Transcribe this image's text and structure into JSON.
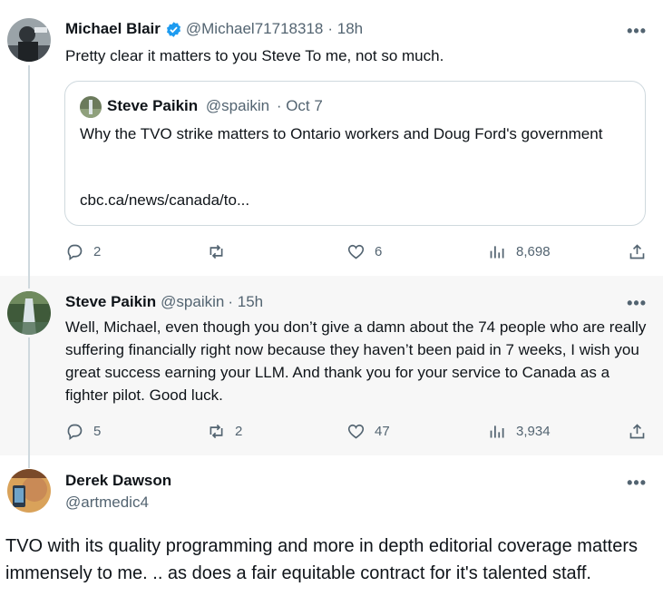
{
  "tweets": [
    {
      "name": "Michael Blair",
      "handle": "@Michael71718318",
      "time": "· 18h",
      "text": "Pretty clear it matters to you Steve   To me, not so much.",
      "quote": {
        "name": "Steve Paikin",
        "handle": "@spaikin",
        "time": "· Oct 7",
        "text": "Why the TVO strike matters to Ontario workers and Doug Ford's government",
        "link": "cbc.ca/news/canada/to..."
      },
      "stats": {
        "replies": "2",
        "retweets": "",
        "likes": "6",
        "views": "8,698"
      }
    },
    {
      "name": "Steve Paikin",
      "handle": "@spaikin",
      "time": "· 15h",
      "text": "Well, Michael, even though you don’t give a damn about the 74 people who are really suffering financially right now because they haven’t been paid in 7 weeks, I wish you great success earning your LLM. And thank you for your service to Canada as a fighter pilot.  Good luck.",
      "stats": {
        "replies": "5",
        "retweets": "2",
        "likes": "47",
        "views": "3,934"
      }
    },
    {
      "name": "Derek Dawson",
      "handle": "@artmedic4",
      "text": "TVO with its quality programming and more in depth editorial coverage matters immensely to me. .. as does a fair  equitable contract  for it's talented staff."
    }
  ],
  "icons": {
    "verified": "verified-badge-icon",
    "more": "more-dots-icon",
    "reply": "reply-icon",
    "retweet": "retweet-icon",
    "like": "heart-icon",
    "views": "views-chart-icon",
    "share": "share-icon"
  },
  "colors": {
    "accent": "#1d9bf0",
    "muted": "#536471",
    "border": "#cfd9de",
    "highlight_bg": "#f7f7f7"
  }
}
